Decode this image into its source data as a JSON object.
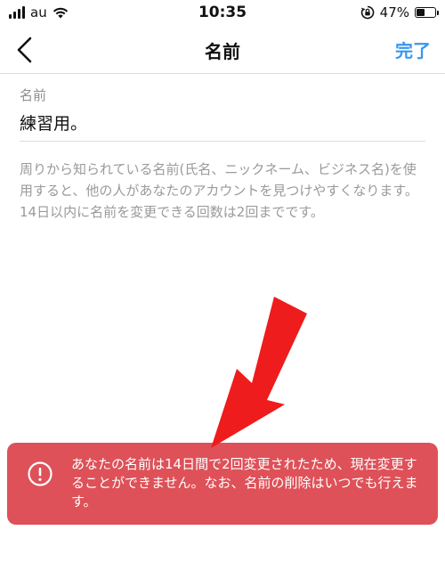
{
  "status_bar": {
    "carrier": "au",
    "time": "10:35",
    "battery_percent": "47%",
    "battery_level": 0.47,
    "icons": [
      "signal-icon",
      "wifi-icon",
      "orientation-lock-icon",
      "battery-icon"
    ]
  },
  "nav": {
    "title": "名前",
    "done_label": "完了",
    "accent_color": "#3897f0"
  },
  "form": {
    "name_label": "名前",
    "name_value": "練習用。",
    "help_text": "周りから知られている名前(氏名、ニックネーム、ビジネス名)を使用すると、他の人があなたのアカウントを見つけやすくなります。14日以内に名前を変更できる回数は2回までです。"
  },
  "toast": {
    "message": "あなたの名前は14日間で2回変更されたため、現在変更することができません。なお、名前の削除はいつでも行えます。",
    "background_color": "#de5158",
    "icon": "alert-circle-icon"
  },
  "annotation": {
    "arrow_color": "#ee1c1c"
  }
}
